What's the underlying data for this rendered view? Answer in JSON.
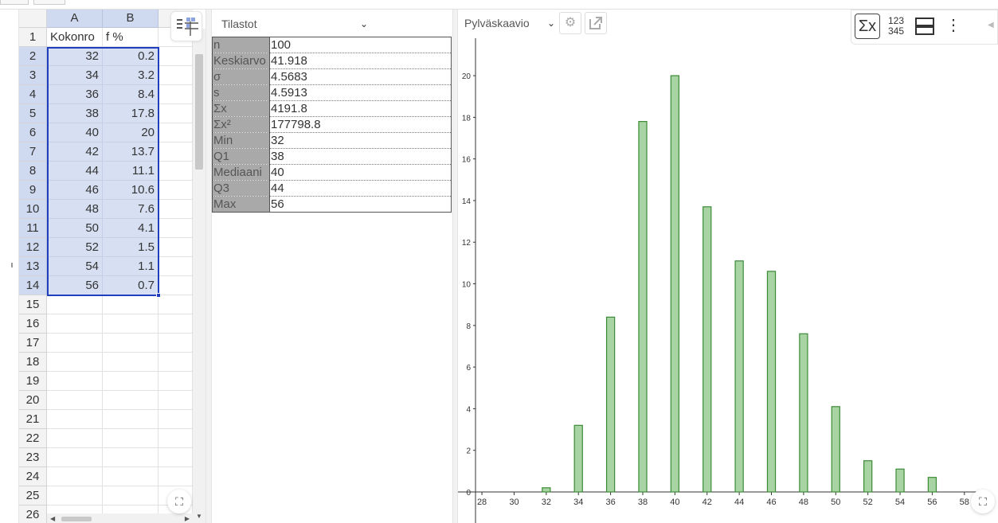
{
  "spreadsheet": {
    "columns": [
      "A",
      "B"
    ],
    "rows": [
      {
        "n": "1",
        "a": "Kokonro",
        "b": "f %"
      },
      {
        "n": "2",
        "a": "32",
        "b": "0.2"
      },
      {
        "n": "3",
        "a": "34",
        "b": "3.2"
      },
      {
        "n": "4",
        "a": "36",
        "b": "8.4"
      },
      {
        "n": "5",
        "a": "38",
        "b": "17.8"
      },
      {
        "n": "6",
        "a": "40",
        "b": "20"
      },
      {
        "n": "7",
        "a": "42",
        "b": "13.7"
      },
      {
        "n": "8",
        "a": "44",
        "b": "11.1"
      },
      {
        "n": "9",
        "a": "46",
        "b": "10.6"
      },
      {
        "n": "10",
        "a": "48",
        "b": "7.6"
      },
      {
        "n": "11",
        "a": "50",
        "b": "4.1"
      },
      {
        "n": "12",
        "a": "52",
        "b": "1.5"
      },
      {
        "n": "13",
        "a": "54",
        "b": "1.1"
      },
      {
        "n": "14",
        "a": "56",
        "b": "0.7"
      },
      {
        "n": "15",
        "a": "",
        "b": ""
      },
      {
        "n": "16",
        "a": "",
        "b": ""
      },
      {
        "n": "17",
        "a": "",
        "b": ""
      },
      {
        "n": "18",
        "a": "",
        "b": ""
      },
      {
        "n": "19",
        "a": "",
        "b": ""
      },
      {
        "n": "20",
        "a": "",
        "b": ""
      },
      {
        "n": "21",
        "a": "",
        "b": ""
      },
      {
        "n": "22",
        "a": "",
        "b": ""
      },
      {
        "n": "23",
        "a": "",
        "b": ""
      },
      {
        "n": "24",
        "a": "",
        "b": ""
      },
      {
        "n": "25",
        "a": "",
        "b": ""
      },
      {
        "n": "26",
        "a": "",
        "b": ""
      }
    ]
  },
  "stats": {
    "dropdown": "Tilastot",
    "rows": [
      {
        "k": "n",
        "v": "100"
      },
      {
        "k": "Keskiarvo",
        "v": "41.918"
      },
      {
        "k": "σ",
        "v": "4.5683"
      },
      {
        "k": "s",
        "v": "4.5913"
      },
      {
        "k": "Σx",
        "v": "4191.8"
      },
      {
        "k": "Σx²",
        "v": "177798.8"
      },
      {
        "k": "Min",
        "v": "32"
      },
      {
        "k": "Q1",
        "v": "38"
      },
      {
        "k": "Mediaani",
        "v": "40"
      },
      {
        "k": "Q3",
        "v": "44"
      },
      {
        "k": "Max",
        "v": "56"
      }
    ]
  },
  "chart_panel": {
    "dropdown": "Pylväskaavio",
    "settings_icon": "gear-icon",
    "export_icon": "external-window-icon",
    "toolbar": {
      "sigma_label": "Σx",
      "numbers_label_top": "123",
      "numbers_label_bottom": "345",
      "layout_icon": "split-rows-icon",
      "more_icon": "more-vertical-icon"
    }
  },
  "chart_data": {
    "type": "bar",
    "title": "",
    "xlabel": "",
    "ylabel": "",
    "categories": [
      32,
      34,
      36,
      38,
      40,
      42,
      44,
      46,
      48,
      50,
      52,
      54,
      56
    ],
    "values": [
      0.2,
      3.2,
      8.4,
      17.8,
      20,
      13.7,
      11.1,
      10.6,
      7.6,
      4.1,
      1.5,
      1.1,
      0.7
    ],
    "xlim": [
      27.6,
      59
    ],
    "ylim": [
      0,
      21.8
    ],
    "xticks": [
      28,
      30,
      32,
      34,
      36,
      38,
      40,
      42,
      44,
      46,
      48,
      50,
      52,
      54,
      56,
      58
    ],
    "yticks": [
      0,
      2,
      4,
      6,
      8,
      10,
      12,
      14,
      16,
      18,
      20
    ],
    "bar_width": 0.5,
    "bar_fill": "#a8d4a4",
    "bar_stroke": "#3c8a36",
    "grid": false
  }
}
